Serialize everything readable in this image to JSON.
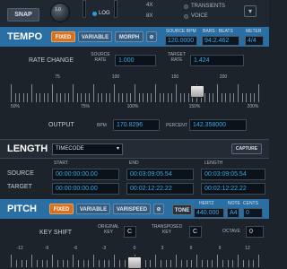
{
  "topbar": {
    "snap": "SNAP",
    "knob_value": "1.0",
    "log": "LOG",
    "x4": "4X",
    "x8": "8X",
    "transients": "TRANSIENTS",
    "voice": "VOICE",
    "chevron_icon": "chevron-down-icon"
  },
  "tempo": {
    "title": "TEMPO",
    "modes": [
      "FIXED",
      "VARIABLE",
      "MORPH"
    ],
    "active_mode": "FIXED",
    "source_bpm_label": "SOURCE BPM",
    "source_bpm": "120.0000",
    "bars_beats_label": "BARS : BEATS",
    "bars_beats": "94:2.462",
    "meter_label": "METER",
    "meter": "4/4",
    "rate_change": "RATE CHANGE",
    "source_rate_label": "SOURCE RATE",
    "source_rate": "1.000",
    "target_rate_label": "TARGET RATE",
    "target_rate": "1.424",
    "scale_top": [
      "75",
      "100",
      "150",
      "200"
    ],
    "scale_bottom": [
      "50%",
      "75%",
      "100%",
      "150%",
      "200%"
    ],
    "slider_level_percent": 142.358,
    "output_label": "OUTPUT",
    "bpm_label": "BPM",
    "bpm": "170.8296",
    "percent_label": "PERCENT",
    "percent": "142.358000"
  },
  "length": {
    "title": "LENGTH",
    "format": "TIMECODE",
    "capture": "CAPTURE",
    "start_label": "START",
    "end_label": "END",
    "length_label": "LENGTH",
    "source_label": "SOURCE",
    "target_label": "TARGET",
    "source_start": "00:00:00:00.00",
    "source_end": "00:03:09:05.54",
    "source_length": "00:03:09:05.54",
    "target_start": "00:00:00:00.00",
    "target_end": "00:02:12:22.22",
    "target_length": "00:02:12:22.22"
  },
  "pitch": {
    "title": "PITCH",
    "modes": [
      "FIXED",
      "VARIABLE",
      "VARISPEED"
    ],
    "active_mode": "FIXED",
    "tone": "TONE",
    "hertz_label": "HERTZ",
    "hertz": "440.000",
    "note_label": "NOTE",
    "note": "A4",
    "cents_label": "CENTS",
    "cents": "0",
    "key_shift": "KEY SHIFT",
    "original_key_label": "ORIGINAL KEY",
    "original_key": "C",
    "transposed_key_label": "TRANSPOSED KEY",
    "transposed_key": "C",
    "octave_label": "OCTAVE",
    "octave": "0",
    "scale": [
      "-12",
      "-9",
      "-6",
      "-3",
      "0",
      "3",
      "6",
      "9",
      "12"
    ]
  }
}
